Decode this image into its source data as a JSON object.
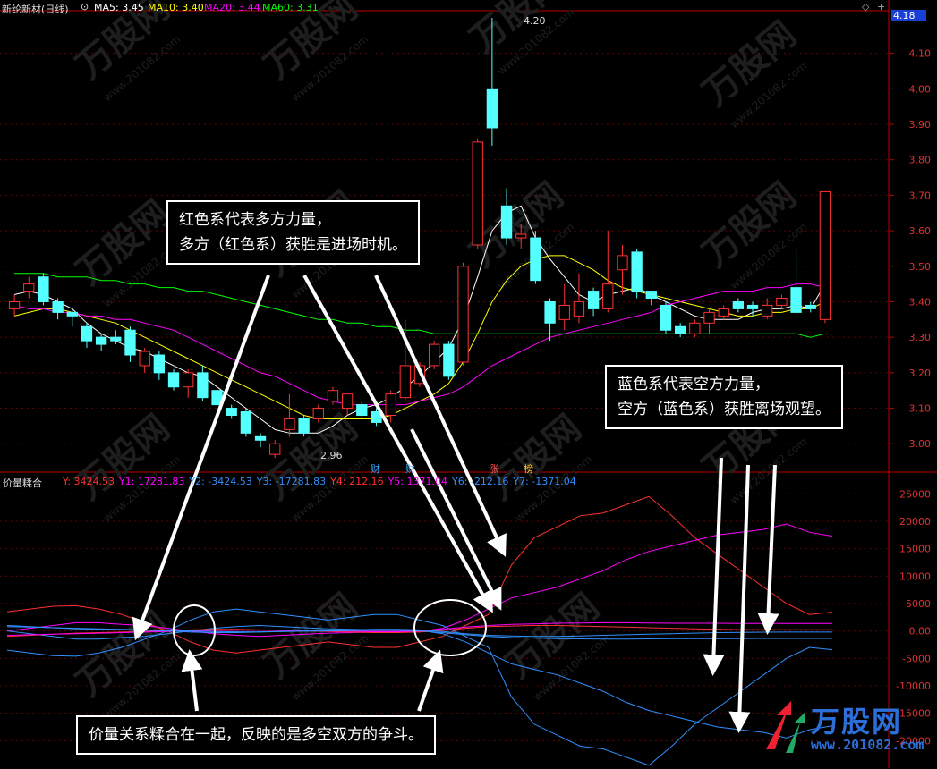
{
  "header": {
    "stock_name": "新纶新材(日线)",
    "ma5": "MA5: 3.45",
    "ma10": "MA10: 3.40",
    "ma20": "MA20: 3.44",
    "ma60": "MA60: 3.31",
    "colors": {
      "ma5": "#ffffff",
      "ma10": "#ffff00",
      "ma20": "#ff00ff",
      "ma60": "#00ff00"
    }
  },
  "price_axis": {
    "current_price_tag": "4.18",
    "ticks": [
      "4.10",
      "4.00",
      "3.90",
      "3.80",
      "3.70",
      "3.60",
      "3.50",
      "3.40",
      "3.30",
      "3.20",
      "3.10",
      "3.00"
    ],
    "high_label": "4.20",
    "low_label": "2.96"
  },
  "event_markers": [
    "财",
    "财",
    "涨",
    "榜"
  ],
  "indicator": {
    "name": "价量糅合",
    "values": [
      {
        "text": "Y: 3424.53",
        "color": "#ff3030"
      },
      {
        "text": "Y1: 17281.83",
        "color": "#ff00ff"
      },
      {
        "text": "Y2: -3424.53",
        "color": "#3090ff"
      },
      {
        "text": "Y3: -17281.83",
        "color": "#3090ff"
      },
      {
        "text": "Y4: 212.16",
        "color": "#ff3030"
      },
      {
        "text": "Y5: 1371.04",
        "color": "#ff00ff"
      },
      {
        "text": "Y6: -212.16",
        "color": "#3090ff"
      },
      {
        "text": "Y7: -1371.04",
        "color": "#3090ff"
      }
    ],
    "axis_ticks": [
      "25000",
      "20000",
      "15000",
      "10000",
      "5000",
      "0.00",
      "-5000",
      "-10000",
      "-15000",
      "-20000"
    ]
  },
  "annotations": {
    "red": [
      "红色系代表多方力量，",
      "多方（红色系）获胜是进场时机。"
    ],
    "blue": [
      "蓝色系代表空方力量，",
      "空方（蓝色系）获胜离场观望。"
    ],
    "bottom": "价量关系糅合在一起，反映的是多空双方的争斗。"
  },
  "watermark": {
    "brand": "万股网",
    "url": "www.201082.com"
  },
  "chart_data": {
    "type": "candlestick",
    "price_ylim": [
      2.92,
      4.22
    ],
    "candles": [
      [
        3.38,
        3.4,
        3.36,
        3.42
      ],
      [
        3.43,
        3.45,
        3.41,
        3.47
      ],
      [
        3.47,
        3.4,
        3.39,
        3.48
      ],
      [
        3.4,
        3.37,
        3.35,
        3.41
      ],
      [
        3.37,
        3.36,
        3.33,
        3.38
      ],
      [
        3.33,
        3.29,
        3.27,
        3.34
      ],
      [
        3.3,
        3.28,
        3.26,
        3.31
      ],
      [
        3.3,
        3.29,
        3.28,
        3.32
      ],
      [
        3.32,
        3.25,
        3.23,
        3.33
      ],
      [
        3.22,
        3.26,
        3.2,
        3.27
      ],
      [
        3.25,
        3.2,
        3.18,
        3.26
      ],
      [
        3.2,
        3.16,
        3.15,
        3.21
      ],
      [
        3.16,
        3.2,
        3.13,
        3.21
      ],
      [
        3.2,
        3.13,
        3.12,
        3.22
      ],
      [
        3.15,
        3.11,
        3.08,
        3.16
      ],
      [
        3.1,
        3.08,
        3.07,
        3.11
      ],
      [
        3.09,
        3.03,
        3.02,
        3.1
      ],
      [
        3.02,
        3.01,
        2.99,
        3.03
      ],
      [
        2.97,
        3.0,
        2.96,
        3.01
      ],
      [
        3.04,
        3.07,
        3.02,
        3.14
      ],
      [
        3.07,
        3.03,
        3.02,
        3.08
      ],
      [
        3.07,
        3.1,
        3.06,
        3.11
      ],
      [
        3.12,
        3.15,
        3.11,
        3.16
      ],
      [
        3.1,
        3.14,
        3.08,
        3.11
      ],
      [
        3.11,
        3.08,
        3.07,
        3.12
      ],
      [
        3.09,
        3.06,
        3.05,
        3.1
      ],
      [
        3.08,
        3.14,
        3.06,
        3.15
      ],
      [
        3.13,
        3.22,
        3.12,
        3.35
      ],
      [
        3.17,
        3.22,
        3.16,
        3.23
      ],
      [
        3.22,
        3.28,
        3.21,
        3.29
      ],
      [
        3.28,
        3.19,
        3.18,
        3.29
      ],
      [
        3.23,
        3.5,
        3.22,
        3.51
      ],
      [
        3.56,
        3.85,
        3.55,
        3.86
      ],
      [
        4.0,
        3.89,
        3.84,
        4.2
      ],
      [
        3.67,
        3.58,
        3.56,
        3.72
      ],
      [
        3.58,
        3.59,
        3.55,
        3.62
      ],
      [
        3.58,
        3.46,
        3.45,
        3.6
      ],
      [
        3.4,
        3.34,
        3.29,
        3.41
      ],
      [
        3.35,
        3.39,
        3.32,
        3.45
      ],
      [
        3.36,
        3.4,
        3.34,
        3.48
      ],
      [
        3.43,
        3.38,
        3.36,
        3.44
      ],
      [
        3.38,
        3.45,
        3.37,
        3.6
      ],
      [
        3.49,
        3.53,
        3.42,
        3.56
      ],
      [
        3.54,
        3.43,
        3.41,
        3.55
      ],
      [
        3.43,
        3.41,
        3.39,
        3.42
      ],
      [
        3.39,
        3.32,
        3.31,
        3.4
      ],
      [
        3.33,
        3.31,
        3.3,
        3.34
      ],
      [
        3.31,
        3.34,
        3.3,
        3.35
      ],
      [
        3.34,
        3.37,
        3.31,
        3.38
      ],
      [
        3.36,
        3.38,
        3.35,
        3.39
      ],
      [
        3.4,
        3.38,
        3.37,
        3.41
      ],
      [
        3.39,
        3.38,
        3.36,
        3.4
      ],
      [
        3.36,
        3.39,
        3.35,
        3.41
      ],
      [
        3.39,
        3.41,
        3.38,
        3.42
      ],
      [
        3.44,
        3.37,
        3.36,
        3.55
      ],
      [
        3.39,
        3.38,
        3.37,
        3.4
      ],
      [
        3.35,
        3.71,
        3.34,
        3.71
      ]
    ],
    "ma5": [
      3.42,
      3.43,
      3.42,
      3.4,
      3.38,
      3.34,
      3.31,
      3.29,
      3.27,
      3.26,
      3.24,
      3.22,
      3.2,
      3.19,
      3.16,
      3.13,
      3.1,
      3.07,
      3.04,
      3.03,
      3.03,
      3.03,
      3.05,
      3.08,
      3.1,
      3.11,
      3.13,
      3.16,
      3.19,
      3.23,
      3.27,
      3.35,
      3.47,
      3.6,
      3.65,
      3.67,
      3.58,
      3.52,
      3.47,
      3.42,
      3.4,
      3.42,
      3.43,
      3.44,
      3.42,
      3.4,
      3.38,
      3.36,
      3.35,
      3.35,
      3.35,
      3.37,
      3.38,
      3.38,
      3.39,
      3.38,
      3.45
    ],
    "ma10": [
      3.36,
      3.37,
      3.38,
      3.38,
      3.37,
      3.36,
      3.35,
      3.34,
      3.32,
      3.3,
      3.28,
      3.26,
      3.24,
      3.22,
      3.2,
      3.18,
      3.16,
      3.14,
      3.12,
      3.1,
      3.08,
      3.07,
      3.07,
      3.07,
      3.07,
      3.07,
      3.08,
      3.1,
      3.12,
      3.14,
      3.17,
      3.23,
      3.31,
      3.4,
      3.46,
      3.5,
      3.52,
      3.53,
      3.53,
      3.51,
      3.49,
      3.46,
      3.44,
      3.43,
      3.42,
      3.41,
      3.4,
      3.39,
      3.38,
      3.37,
      3.36,
      3.36,
      3.37,
      3.37,
      3.38,
      3.38,
      3.4
    ],
    "ma20": [
      3.39,
      3.38,
      3.38,
      3.37,
      3.37,
      3.36,
      3.36,
      3.35,
      3.35,
      3.34,
      3.33,
      3.32,
      3.3,
      3.28,
      3.26,
      3.24,
      3.22,
      3.2,
      3.19,
      3.17,
      3.15,
      3.13,
      3.12,
      3.11,
      3.11,
      3.11,
      3.11,
      3.11,
      3.12,
      3.13,
      3.14,
      3.16,
      3.19,
      3.22,
      3.24,
      3.26,
      3.28,
      3.3,
      3.31,
      3.32,
      3.33,
      3.34,
      3.35,
      3.36,
      3.37,
      3.39,
      3.4,
      3.41,
      3.42,
      3.43,
      3.43,
      3.43,
      3.44,
      3.44,
      3.45,
      3.45,
      3.44
    ],
    "ma60": [
      3.48,
      3.48,
      3.48,
      3.47,
      3.47,
      3.47,
      3.46,
      3.46,
      3.45,
      3.45,
      3.44,
      3.44,
      3.43,
      3.43,
      3.42,
      3.41,
      3.4,
      3.39,
      3.38,
      3.37,
      3.36,
      3.35,
      3.35,
      3.34,
      3.34,
      3.33,
      3.33,
      3.32,
      3.32,
      3.31,
      3.31,
      3.31,
      3.31,
      3.31,
      3.31,
      3.31,
      3.31,
      3.31,
      3.31,
      3.31,
      3.31,
      3.31,
      3.31,
      3.31,
      3.31,
      3.31,
      3.31,
      3.31,
      3.31,
      3.31,
      3.31,
      3.31,
      3.31,
      3.31,
      3.31,
      3.3,
      3.31
    ],
    "indicator_ylim": [
      -25000,
      27000
    ],
    "indicator_series": [
      {
        "name": "Y",
        "color": "#ff3030",
        "values": [
          3500,
          4000,
          4500,
          4600,
          4000,
          3000,
          1500,
          0,
          -2000,
          -3500,
          -4000,
          -3500,
          -3000,
          -2500,
          -2000,
          -2500,
          -3000,
          -3000,
          -2000,
          -1000,
          1000,
          3000,
          12000,
          17000,
          19000,
          21000,
          21500,
          23000,
          24500,
          21000,
          17000,
          14000,
          11000,
          8000,
          5000,
          3000,
          3424
        ]
      },
      {
        "name": "Y1",
        "color": "#ff00ff",
        "values": [
          0,
          500,
          1000,
          1500,
          1500,
          1200,
          1000,
          500,
          0,
          -500,
          -800,
          -1000,
          -800,
          -600,
          -400,
          -300,
          -200,
          -200,
          -100,
          500,
          2000,
          4000,
          6000,
          7000,
          8000,
          9500,
          11000,
          13000,
          14500,
          15500,
          16500,
          17500,
          18000,
          18500,
          19500,
          18000,
          17281
        ]
      },
      {
        "name": "Y2",
        "color": "#3090ff",
        "values": [
          -3500,
          -4000,
          -4500,
          -4600,
          -4000,
          -3000,
          -1500,
          0,
          2000,
          3500,
          4000,
          3500,
          3000,
          2500,
          2000,
          2500,
          3000,
          3000,
          2000,
          1000,
          -1000,
          -3000,
          -12000,
          -17000,
          -19000,
          -21000,
          -21500,
          -23000,
          -24500,
          -21000,
          -17000,
          -14000,
          -11000,
          -8000,
          -5000,
          -3000,
          -3424
        ]
      },
      {
        "name": "Y3",
        "color": "#3090ff",
        "values": [
          0,
          -500,
          -1000,
          -1500,
          -1500,
          -1200,
          -1000,
          -500,
          0,
          500,
          800,
          1000,
          800,
          600,
          400,
          300,
          200,
          200,
          100,
          -500,
          -2000,
          -4000,
          -6000,
          -7000,
          -8000,
          -9500,
          -11000,
          -13000,
          -14500,
          -15500,
          -16500,
          -17500,
          -18000,
          -18500,
          -19500,
          -18000,
          -17281
        ]
      },
      {
        "name": "Y4",
        "color": "#ff3030",
        "values": [
          -1000,
          -800,
          -600,
          -400,
          -300,
          -200,
          -100,
          0,
          200,
          300,
          300,
          200,
          100,
          0,
          -100,
          -200,
          -300,
          -300,
          -200,
          100,
          500,
          800,
          900,
          1000,
          1000,
          900,
          800,
          700,
          600,
          500,
          400,
          300,
          250,
          220,
          210,
          212,
          212
        ]
      },
      {
        "name": "Y5",
        "color": "#ff00ff",
        "values": [
          -800,
          -700,
          -600,
          -500,
          -400,
          -300,
          -200,
          -100,
          0,
          100,
          150,
          150,
          100,
          50,
          0,
          -50,
          -100,
          -100,
          0,
          300,
          700,
          1000,
          1200,
          1300,
          1400,
          1450,
          1500,
          1500,
          1450,
          1400,
          1400,
          1400,
          1380,
          1370,
          1370,
          1371,
          1371
        ]
      },
      {
        "name": "Y6",
        "color": "#3090ff",
        "values": [
          1000,
          800,
          600,
          400,
          300,
          200,
          100,
          0,
          -200,
          -300,
          -300,
          -200,
          -100,
          0,
          100,
          200,
          300,
          300,
          200,
          -100,
          -500,
          -800,
          -900,
          -1000,
          -1000,
          -900,
          -800,
          -700,
          -600,
          -500,
          -400,
          -300,
          -250,
          -220,
          -210,
          -212,
          -212
        ]
      },
      {
        "name": "Y7",
        "color": "#3090ff",
        "values": [
          800,
          700,
          600,
          500,
          400,
          300,
          200,
          100,
          0,
          -100,
          -150,
          -150,
          -100,
          -50,
          0,
          50,
          100,
          100,
          0,
          -300,
          -700,
          -1000,
          -1200,
          -1300,
          -1400,
          -1450,
          -1500,
          -1500,
          -1450,
          -1400,
          -1400,
          -1400,
          -1380,
          -1370,
          -1370,
          -1371,
          -1371
        ]
      }
    ]
  }
}
